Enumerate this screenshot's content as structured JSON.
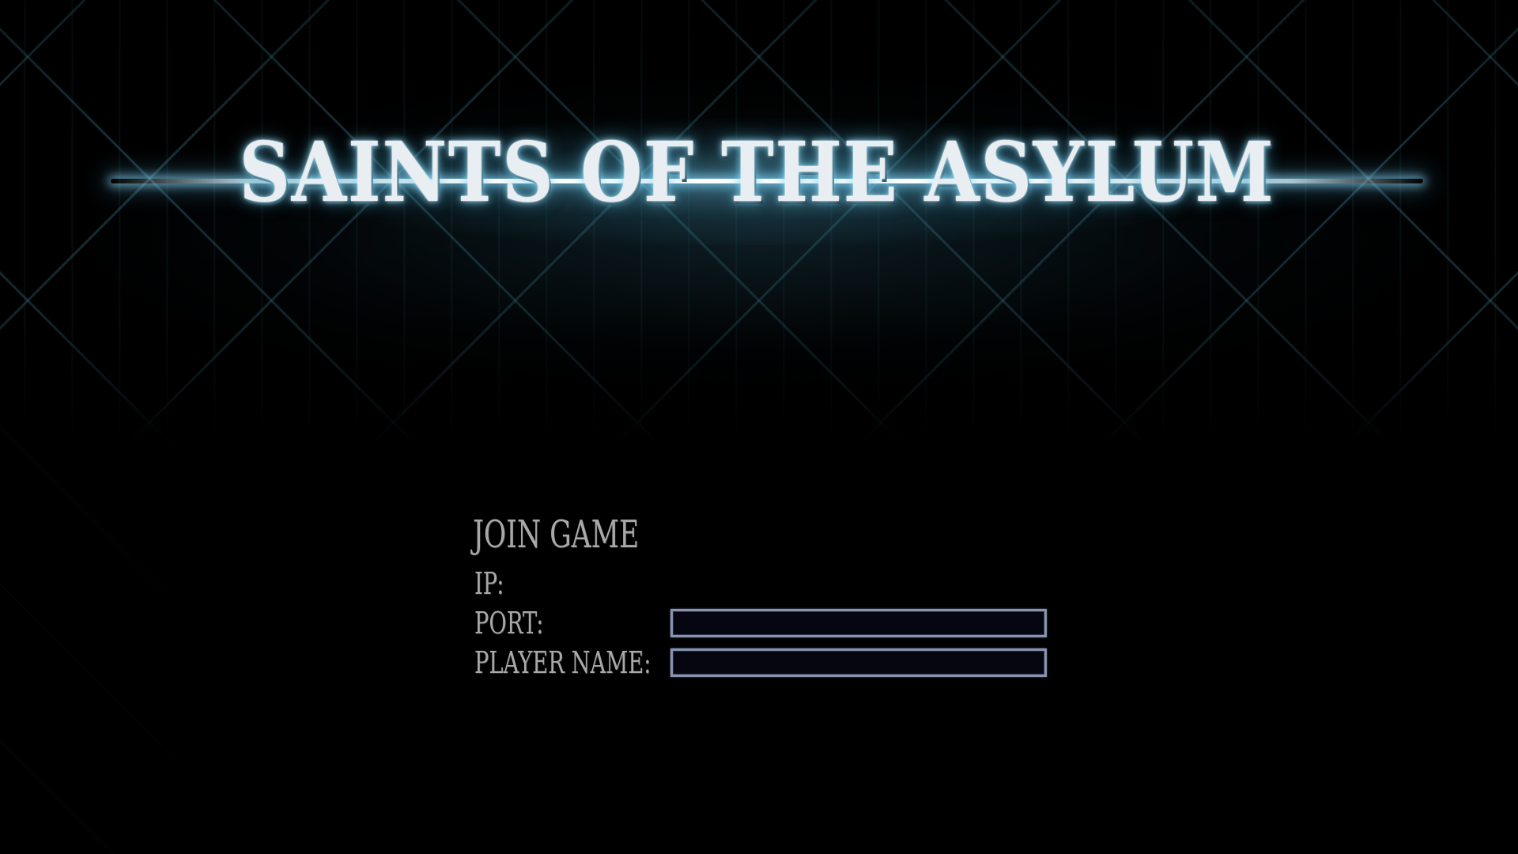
{
  "game": {
    "title": "SAINTS OF THE ASYLUM"
  },
  "join_game": {
    "heading": "JOIN GAME",
    "fields": {
      "ip": {
        "label": "IP:"
      },
      "port": {
        "label": "PORT:",
        "value": ""
      },
      "player_name": {
        "label": "PLAYER NAME:",
        "value": ""
      }
    }
  },
  "colors": {
    "background": "#000000",
    "label_text": "#a8a8a8",
    "input_background": "#05060f",
    "input_border": "#8a93b0",
    "title_glow": "#78d2f0"
  }
}
